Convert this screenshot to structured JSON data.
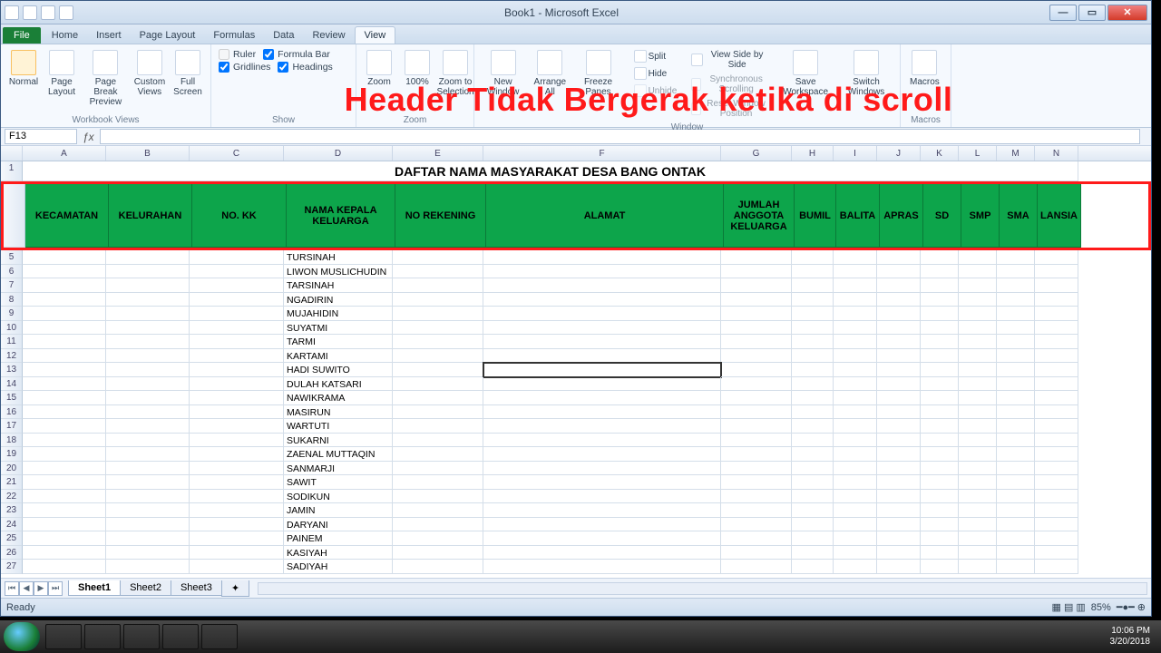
{
  "title": "Book1 - Microsoft Excel",
  "tabs": {
    "file": "File",
    "home": "Home",
    "insert": "Insert",
    "pagelayout": "Page Layout",
    "formulas": "Formulas",
    "data": "Data",
    "review": "Review",
    "view": "View"
  },
  "ribbon": {
    "wv": {
      "normal": "Normal",
      "pagelayout": "Page Layout",
      "pagebreak": "Page Break Preview",
      "custom": "Custom Views",
      "full": "Full Screen",
      "label": "Workbook Views"
    },
    "show": {
      "ruler": "Ruler",
      "formulabar": "Formula Bar",
      "gridlines": "Gridlines",
      "headings": "Headings",
      "label": "Show"
    },
    "zoom": {
      "zoom": "Zoom",
      "p100": "100%",
      "sel": "Zoom to Selection",
      "label": "Zoom"
    },
    "win": {
      "new": "New Window",
      "arrange": "Arrange All",
      "freeze": "Freeze Panes",
      "split": "Split",
      "hide": "Hide",
      "unhide": "Unhide",
      "side": "View Side by Side",
      "sync": "Synchronous Scrolling",
      "reset": "Reset Window Position",
      "save": "Save Workspace",
      "switch": "Switch Windows",
      "label": "Window"
    },
    "mac": {
      "macros": "Macros",
      "label": "Macros"
    }
  },
  "overlay": "Header Tidak Bergerak ketika di scroll",
  "namebox": "F13",
  "cols": [
    "A",
    "B",
    "C",
    "D",
    "E",
    "F",
    "G",
    "H",
    "I",
    "J",
    "K",
    "L",
    "M",
    "N"
  ],
  "doc_title": "DAFTAR NAMA MASYARAKAT DESA BANG ONTAK",
  "headers": [
    "KECAMATAN",
    "KELURAHAN",
    "NO. KK",
    "NAMA KEPALA KELUARGA",
    "NO REKENING",
    "ALAMAT",
    "JUMLAH ANGGOTA KELUARGA",
    "BUMIL",
    "BALITA",
    "APRAS",
    "SD",
    "SMP",
    "SMA",
    "LANSIA"
  ],
  "rows": [
    {
      "n": "5",
      "name": "TURSINAH"
    },
    {
      "n": "6",
      "name": "LIWON MUSLICHUDIN"
    },
    {
      "n": "7",
      "name": "TARSINAH"
    },
    {
      "n": "8",
      "name": "NGADIRIN"
    },
    {
      "n": "9",
      "name": "MUJAHIDIN"
    },
    {
      "n": "10",
      "name": "SUYATMI"
    },
    {
      "n": "11",
      "name": "TARMI"
    },
    {
      "n": "12",
      "name": "KARTAMI"
    },
    {
      "n": "13",
      "name": "HADI SUWITO"
    },
    {
      "n": "14",
      "name": "DULAH KATSARI"
    },
    {
      "n": "15",
      "name": "NAWIKRAMA"
    },
    {
      "n": "16",
      "name": "MASIRUN"
    },
    {
      "n": "17",
      "name": "WARTUTI"
    },
    {
      "n": "18",
      "name": "SUKARNI"
    },
    {
      "n": "19",
      "name": "ZAENAL MUTTAQIN"
    },
    {
      "n": "20",
      "name": "SANMARJI"
    },
    {
      "n": "21",
      "name": "SAWIT"
    },
    {
      "n": "22",
      "name": "SODIKUN"
    },
    {
      "n": "23",
      "name": "JAMIN"
    },
    {
      "n": "24",
      "name": "DARYANI"
    },
    {
      "n": "25",
      "name": "PAINEM"
    },
    {
      "n": "26",
      "name": "KASIYAH"
    },
    {
      "n": "27",
      "name": "SADIYAH"
    }
  ],
  "active_row": "13",
  "sheets": [
    "Sheet1",
    "Sheet2",
    "Sheet3"
  ],
  "status": "Ready",
  "zoom": "85%",
  "tray": {
    "time": "10:06 PM",
    "date": "3/20/2018"
  }
}
